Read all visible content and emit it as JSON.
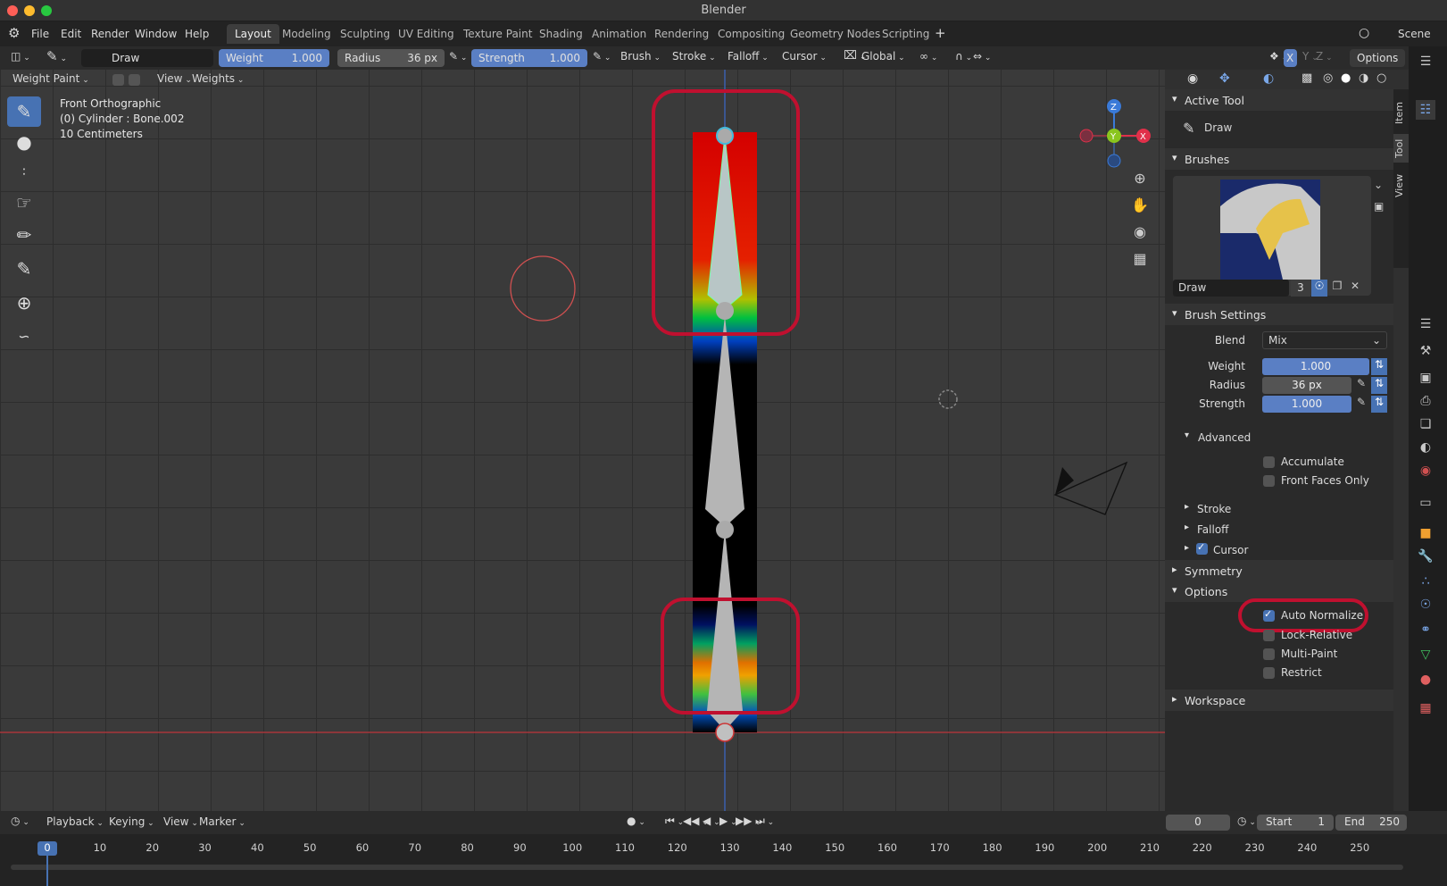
{
  "window": {
    "title": "Blender"
  },
  "menu": [
    "File",
    "Edit",
    "Render",
    "Window",
    "Help"
  ],
  "workspaces": [
    "Layout",
    "Modeling",
    "Sculpting",
    "UV Editing",
    "Texture Paint",
    "Shading",
    "Animation",
    "Rendering",
    "Compositing",
    "Geometry Nodes",
    "Scripting"
  ],
  "active_workspace": "Layout",
  "scene": "Scene",
  "header": {
    "brush_name": "Draw",
    "weight_label": "Weight",
    "weight_value": "1.000",
    "radius_label": "Radius",
    "radius_value": "36 px",
    "strength_label": "Strength",
    "strength_value": "1.000",
    "brush_dd": "Brush",
    "stroke_dd": "Stroke",
    "falloff_dd": "Falloff",
    "cursor_dd": "Cursor",
    "orientation": "Global",
    "options": "Options",
    "axis_x": "X",
    "axis_y": "Y",
    "axis_z": "Z"
  },
  "viewport_header": {
    "mode": "Weight Paint",
    "view": "View",
    "weights": "Weights"
  },
  "overlay": {
    "view_name": "Front Orthographic",
    "object": "(0) Cylinder : Bone.002",
    "scale": "10 Centimeters"
  },
  "gizmo": {
    "z": "Z",
    "y": "Y",
    "x": "X"
  },
  "sidebar_tabs": [
    "Item",
    "Tool",
    "View"
  ],
  "active_tool": {
    "header": "Active Tool",
    "name": "Draw"
  },
  "brushes": {
    "header": "Brushes",
    "name": "Draw",
    "users": "3"
  },
  "brush_settings": {
    "header": "Brush Settings",
    "blend_label": "Blend",
    "blend_value": "Mix",
    "weight_label": "Weight",
    "weight_value": "1.000",
    "radius_label": "Radius",
    "radius_value": "36 px",
    "strength_label": "Strength",
    "strength_value": "1.000",
    "advanced": "Advanced",
    "accumulate": "Accumulate",
    "front_faces_only": "Front Faces Only",
    "stroke": "Stroke",
    "falloff": "Falloff",
    "cursor": "Cursor"
  },
  "symmetry": "Symmetry",
  "options": {
    "header": "Options",
    "auto_normalize": "Auto Normalize",
    "lock_relative": "Lock-Relative",
    "multi_paint": "Multi-Paint",
    "restrict": "Restrict"
  },
  "workspace_panel": "Workspace",
  "timeline": {
    "playback": "Playback",
    "keying": "Keying",
    "view": "View",
    "marker": "Marker",
    "current_frame": "0",
    "start_label": "Start",
    "start_value": "1",
    "end_label": "End",
    "end_value": "250",
    "frames": [
      "0",
      "10",
      "20",
      "30",
      "40",
      "50",
      "60",
      "70",
      "80",
      "90",
      "100",
      "110",
      "120",
      "130",
      "140",
      "150",
      "160",
      "170",
      "180",
      "190",
      "200",
      "210",
      "220",
      "230",
      "240",
      "250"
    ]
  },
  "colors": {
    "accent": "#4772b3",
    "field_blue": "#5a7fc4",
    "highlight": "#c0102f",
    "axis_x": "#e0304a",
    "axis_y": "#8ac51e",
    "axis_z": "#3a7ad8"
  }
}
